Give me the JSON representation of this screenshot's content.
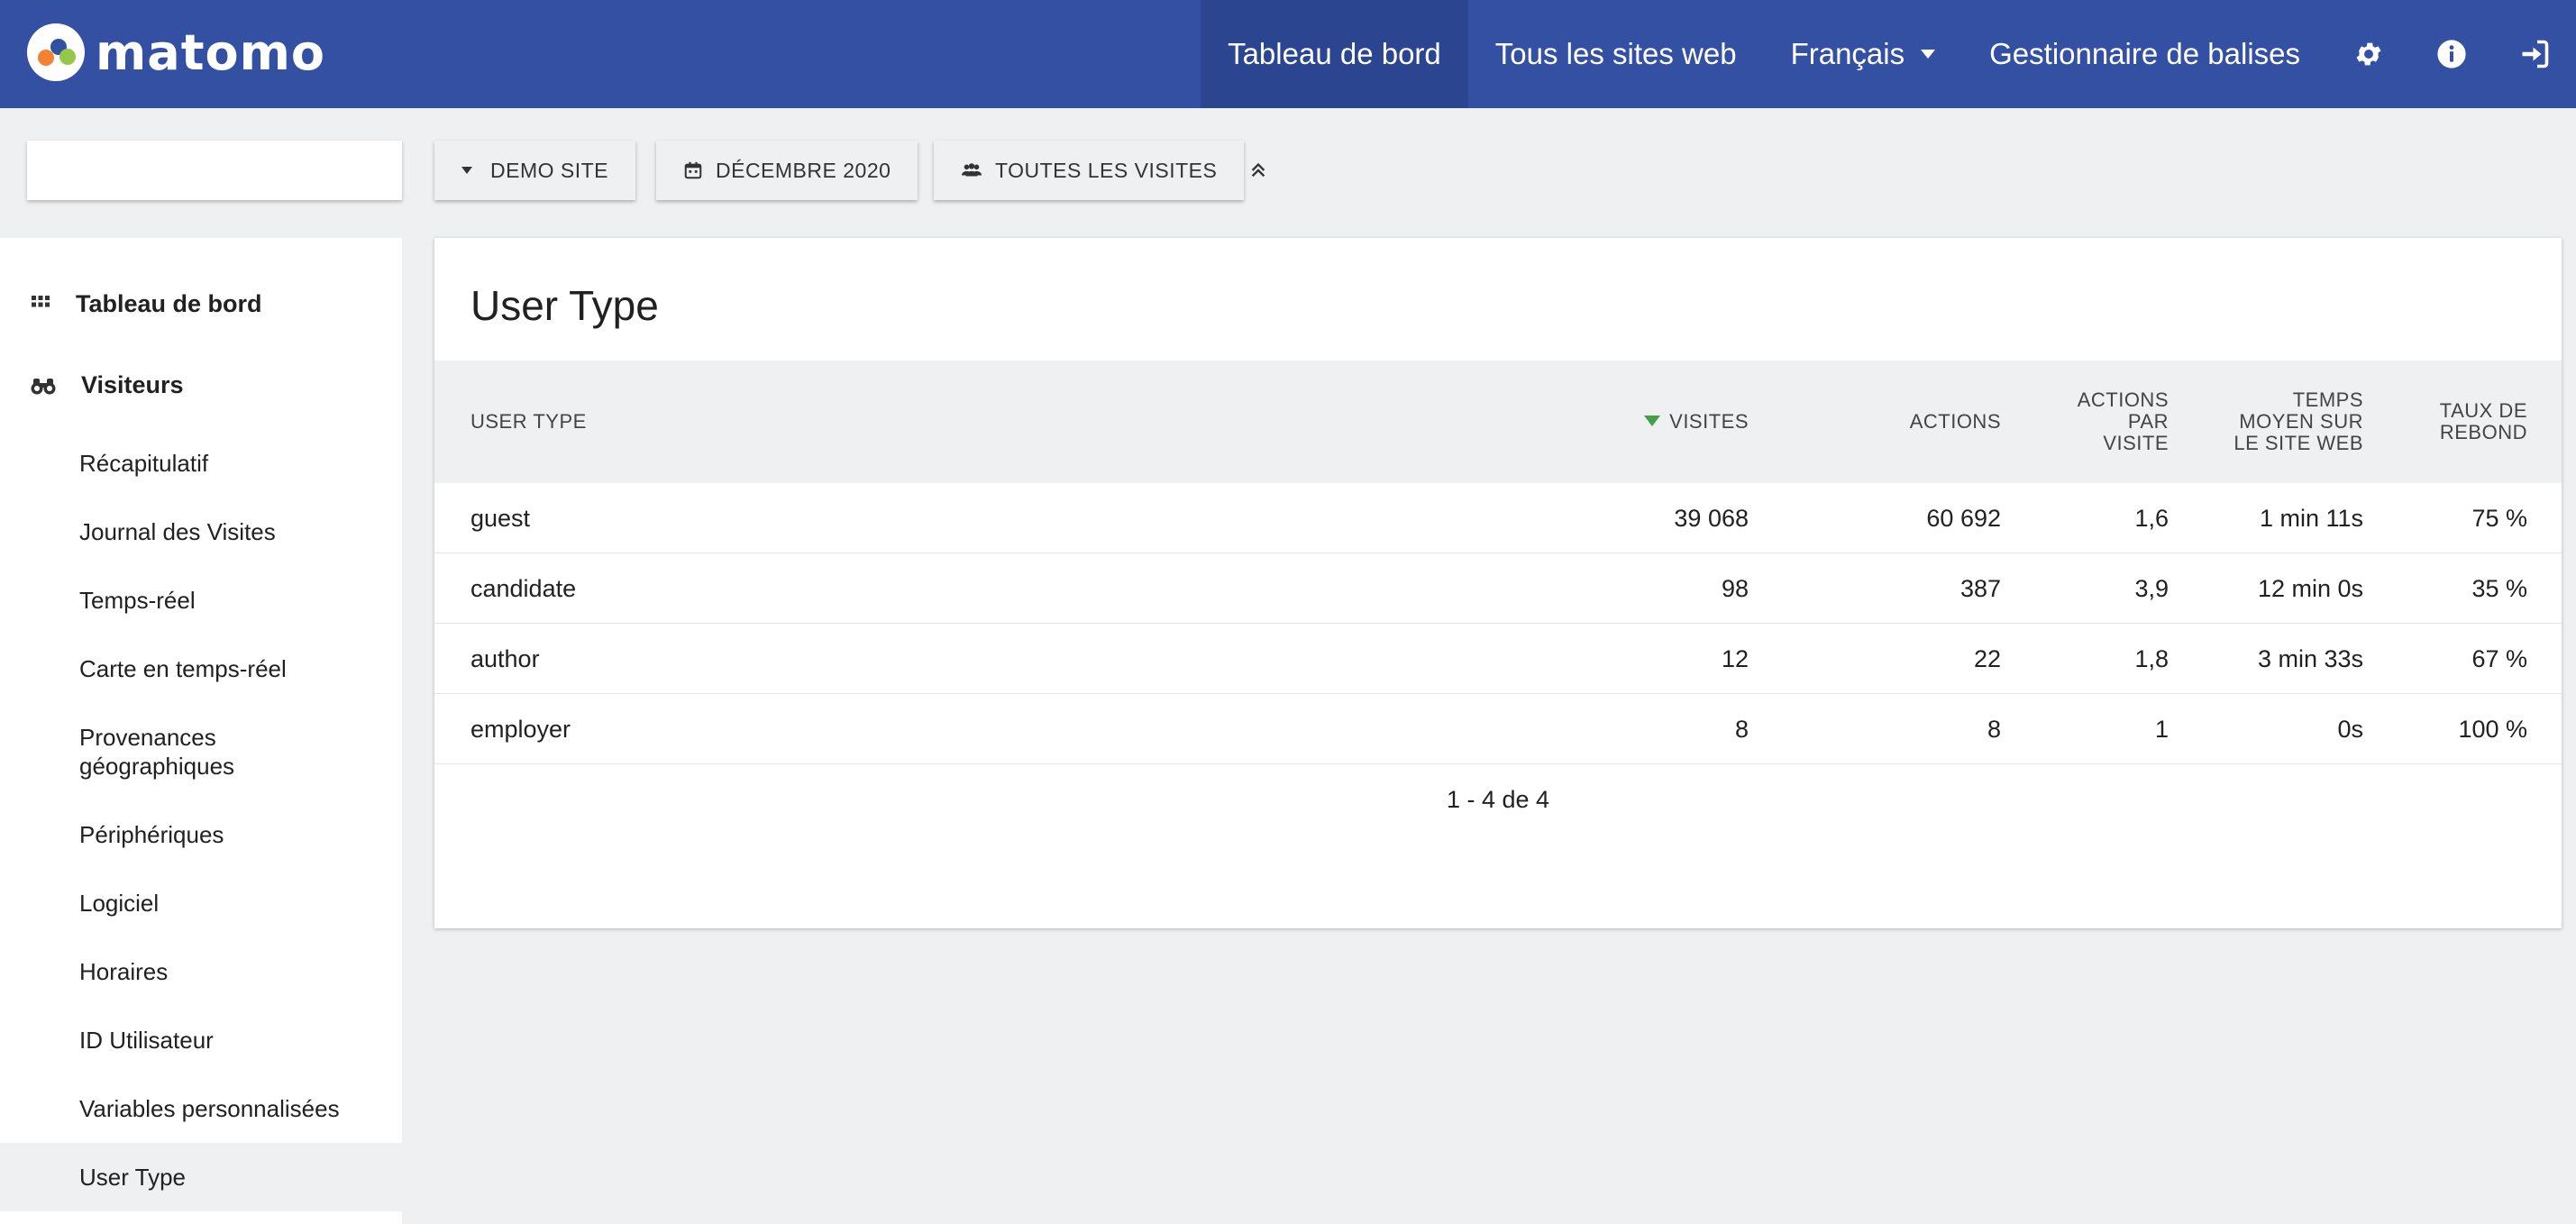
{
  "brand": {
    "name": "matomo"
  },
  "nav": {
    "dashboard": "Tableau de bord",
    "all_websites": "Tous les sites web",
    "language": "Français",
    "tag_manager": "Gestionnaire de balises"
  },
  "selectors": {
    "site": "DEMO SITE",
    "period": "DÉCEMBRE 2020",
    "segment": "TOUTES LES VISITES"
  },
  "search": {
    "value": "",
    "placeholder": ""
  },
  "sidebar": {
    "categories": [
      {
        "label": "Tableau de bord",
        "icon": "grid-icon"
      },
      {
        "label": "Visiteurs",
        "icon": "binoculars-icon"
      }
    ],
    "items": [
      {
        "label": "Récapitulatif"
      },
      {
        "label": "Journal des Visites"
      },
      {
        "label": "Temps-réel"
      },
      {
        "label": "Carte en temps-réel"
      },
      {
        "label": "Provenances\ngéographiques"
      },
      {
        "label": "Périphériques"
      },
      {
        "label": "Logiciel"
      },
      {
        "label": "Horaires"
      },
      {
        "label": "ID Utilisateur"
      },
      {
        "label": "Variables personnalisées"
      },
      {
        "label": "User Type",
        "active": true
      }
    ]
  },
  "report": {
    "title": "User Type",
    "columns": {
      "label": "USER TYPE",
      "visits": "VISITES",
      "actions": "ACTIONS",
      "actions_per_visit": "ACTIONS\nPAR\nVISITE",
      "avg_time": "TEMPS\nMOYEN SUR\nLE SITE WEB",
      "bounce_rate": "TAUX DE\nREBOND"
    },
    "rows": [
      {
        "label": "guest",
        "visits": "39 068",
        "actions": "60 692",
        "apv": "1,6",
        "time": "1 min 11s",
        "bounce": "75 %"
      },
      {
        "label": "candidate",
        "visits": "98",
        "actions": "387",
        "apv": "3,9",
        "time": "12 min 0s",
        "bounce": "35 %"
      },
      {
        "label": "author",
        "visits": "12",
        "actions": "22",
        "apv": "1,8",
        "time": "3 min 33s",
        "bounce": "67 %"
      },
      {
        "label": "employer",
        "visits": "8",
        "actions": "8",
        "apv": "1",
        "time": "0s",
        "bounce": "100 %"
      }
    ],
    "pagination": "1 - 4 de 4"
  },
  "colors": {
    "header": "#3450a3",
    "header_active": "#2b4591",
    "sort_arrow": "#43a047"
  }
}
